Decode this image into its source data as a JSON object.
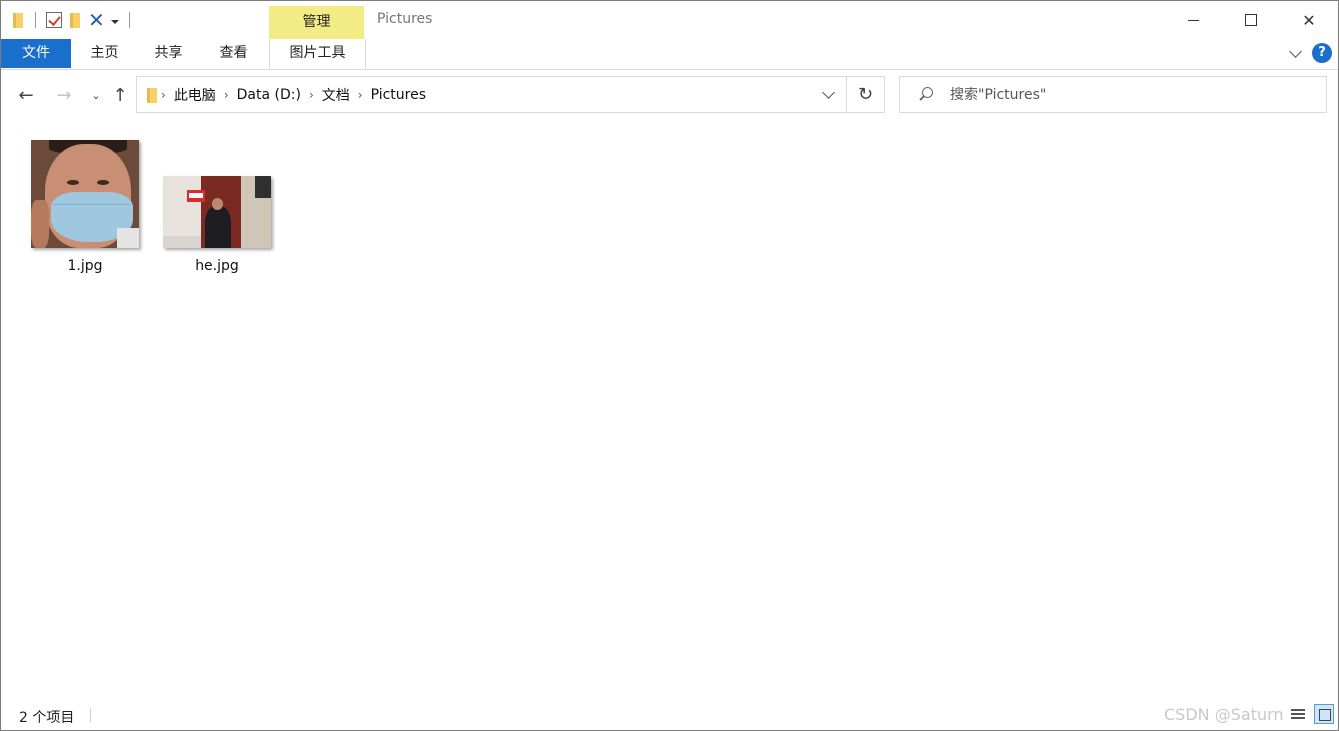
{
  "window": {
    "title": "Pictures"
  },
  "ribbon": {
    "context_tab_label": "管理",
    "tabs": [
      {
        "label": "文件"
      },
      {
        "label": "主页"
      },
      {
        "label": "共享"
      },
      {
        "label": "查看"
      },
      {
        "label": "图片工具"
      }
    ]
  },
  "address": {
    "crumbs": [
      "此电脑",
      "Data (D:)",
      "文档",
      "Pictures"
    ]
  },
  "search": {
    "placeholder": "搜索\"Pictures\""
  },
  "files": [
    {
      "name": "1.jpg"
    },
    {
      "name": "he.jpg"
    }
  ],
  "status": {
    "item_count": "2 个项目",
    "watermark": "CSDN @Saturn"
  },
  "colors": {
    "file_tab": "#1a6fcd",
    "context_tab": "#f3ec85"
  },
  "icons": [
    "folder-icon",
    "properties-icon",
    "new-folder-icon",
    "delete-icon",
    "customize-dropdown-icon",
    "back-icon",
    "forward-icon",
    "recent-locations-icon",
    "up-icon",
    "refresh-icon",
    "search-icon",
    "help-icon",
    "details-view-icon",
    "large-icons-view-icon"
  ]
}
